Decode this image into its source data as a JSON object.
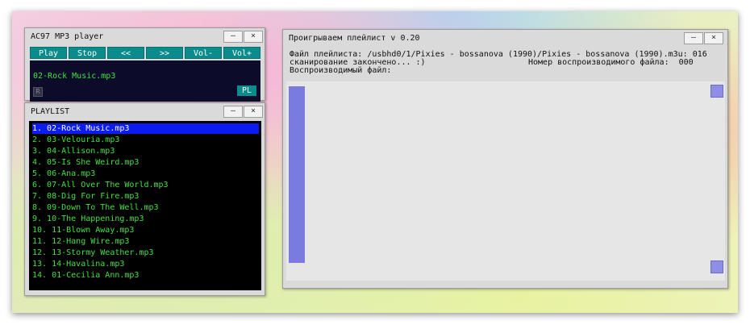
{
  "player": {
    "title": "AC97 MP3 player",
    "controls": [
      "Play",
      "Stop",
      "<<",
      ">>",
      "Vol-",
      "Vol+"
    ],
    "now_playing": "02-Rock Music.mp3",
    "r_label": "R",
    "pl_label": "PL"
  },
  "playlist": {
    "title": "PLAYLIST",
    "selected_index": 0,
    "items": [
      "1. 02-Rock Music.mp3",
      "2. 03-Velouria.mp3",
      "3. 04-Allison.mp3",
      "4. 05-Is She Weird.mp3",
      "5. 06-Ana.mp3",
      "6. 07-All Over The World.mp3",
      "7. 08-Dig For Fire.mp3",
      "8. 09-Down To The Well.mp3",
      "9. 10-The Happening.mp3",
      "10. 11-Blown Away.mp3",
      "11. 12-Hang Wire.mp3",
      "12. 13-Stormy Weather.mp3",
      "13. 14-Havalina.mp3",
      "14. 01-Cecilia Ann.mp3"
    ]
  },
  "main": {
    "title": "Проигрываем плейлист v 0.20",
    "line1": "Файл плейлиста: /usbhd0/1/Pixies - bossanova (1990)/Pixies - bossanova (1990).m3u: 016",
    "line2_left": "сканирование закончено... :)",
    "line2_right": "Номер воспроизводимого файла:  000",
    "line3": "Воспроизводимый файл:"
  },
  "window_buttons": {
    "minimize": "–",
    "close": "×"
  },
  "colors": {
    "accent_teal": "#0b8c8c",
    "playlist_text": "#3ee33e",
    "selection": "#0a1cf0",
    "progress": "#7a7adf"
  }
}
